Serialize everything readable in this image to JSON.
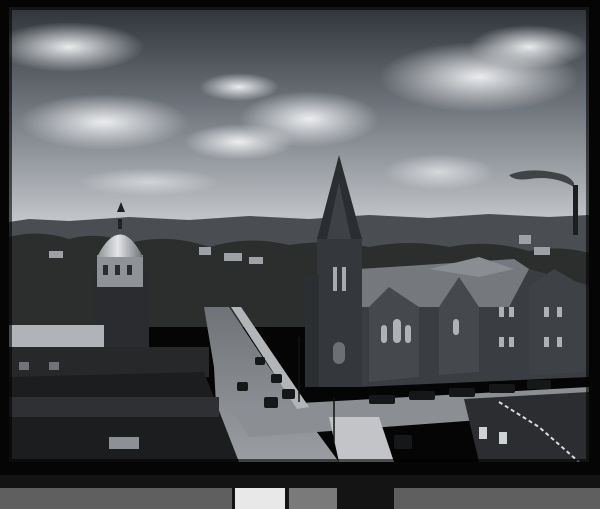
{
  "photo": {
    "subject": "",
    "palette": {
      "sky_top": "#2e3338",
      "sky_horizon": "#b9bdc2",
      "cloud": "#e9ebee",
      "tree": "#2a2d2a",
      "stone": "#3b3e42",
      "roof": "#6e7277",
      "street": "#8e9196",
      "shadow": "#141517"
    }
  }
}
